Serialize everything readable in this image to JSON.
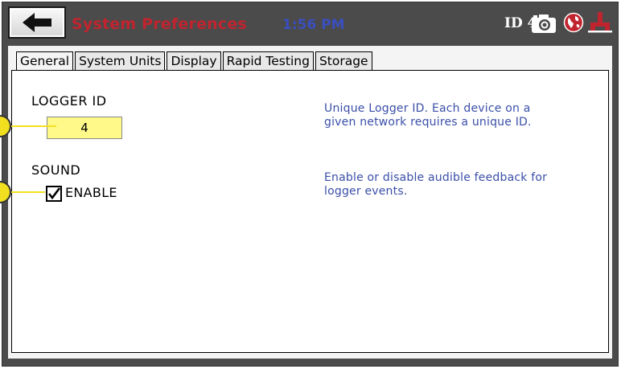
{
  "header": {
    "title": "System Preferences",
    "time": "1:56 PM",
    "id_label": "ID 4",
    "icons": [
      "back-arrow-icon",
      "camera-icon",
      "globe-icon",
      "sensor-icon"
    ]
  },
  "tabs": [
    {
      "label": "General",
      "active": true
    },
    {
      "label": "System Units",
      "active": false
    },
    {
      "label": "Display",
      "active": false
    },
    {
      "label": "Rapid Testing",
      "active": false
    },
    {
      "label": "Storage",
      "active": false
    }
  ],
  "general": {
    "logger_id_label": "LOGGER ID",
    "logger_id_value": "4",
    "logger_id_desc": [
      "Unique Logger ID.  Each device on a",
      "given network requires a unique ID."
    ],
    "sound_label": "SOUND",
    "sound_enabled": true,
    "enable_label": "ENABLE",
    "sound_desc": [
      "Enable or disable audible feedback for",
      "logger events."
    ]
  },
  "colors": {
    "title": "#c0242f",
    "time": "#3a4fbf",
    "description": "#3a4fa8",
    "field_bg": "#fff98a",
    "callout": "#f2df1f"
  }
}
